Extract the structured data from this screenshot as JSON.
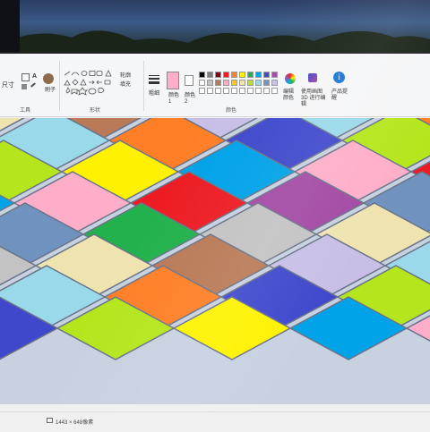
{
  "ribbon": {
    "size_label": "尺寸",
    "tools_group_label": "工具",
    "shapes_group_label": "形状",
    "colors_group_label": "颜色",
    "text_tool_label": "A",
    "brushes_label": "刷子",
    "outline_label": "轮廓",
    "fill_label": "填充",
    "thickness_label": "粗细",
    "color1_label": "颜色 1",
    "color2_label": "颜色 2",
    "edit_colors_label": "编辑颜色",
    "paint3d_label": "使用画图 3D 进行编辑",
    "product_alert_label": "产品提醒",
    "palette": [
      "#000000",
      "#7f7f7f",
      "#880015",
      "#ed1c24",
      "#ff7f27",
      "#fff200",
      "#22b14c",
      "#00a2e8",
      "#3f48cc",
      "#a349a4",
      "#ffffff",
      "#c3c3c3",
      "#b97a57",
      "#ffaec9",
      "#ffc90e",
      "#efe4b0",
      "#b5e61d",
      "#99d9ea",
      "#7092be",
      "#c8bfe7",
      "#ffffff",
      "#ffffff",
      "#ffffff",
      "#ffffff",
      "#ffffff",
      "#ffffff",
      "#ffffff",
      "#ffffff",
      "#ffffff",
      "#ffffff"
    ],
    "color1": "#ffaec9",
    "color2": "#ffffff"
  },
  "status": {
    "dimensions": "1443 × 648像素"
  },
  "canvas_colors": [
    "#ed1c24",
    "#00a2e8",
    "#b5e61d",
    "#ff7f27",
    "#c8bfe7",
    "#efe4b0",
    "#22b14c",
    "#a349a4",
    "#ffaec9",
    "#fff200",
    "#3f48cc",
    "#99d9ea",
    "#b97a57",
    "#c3c3c3",
    "#7092be"
  ]
}
